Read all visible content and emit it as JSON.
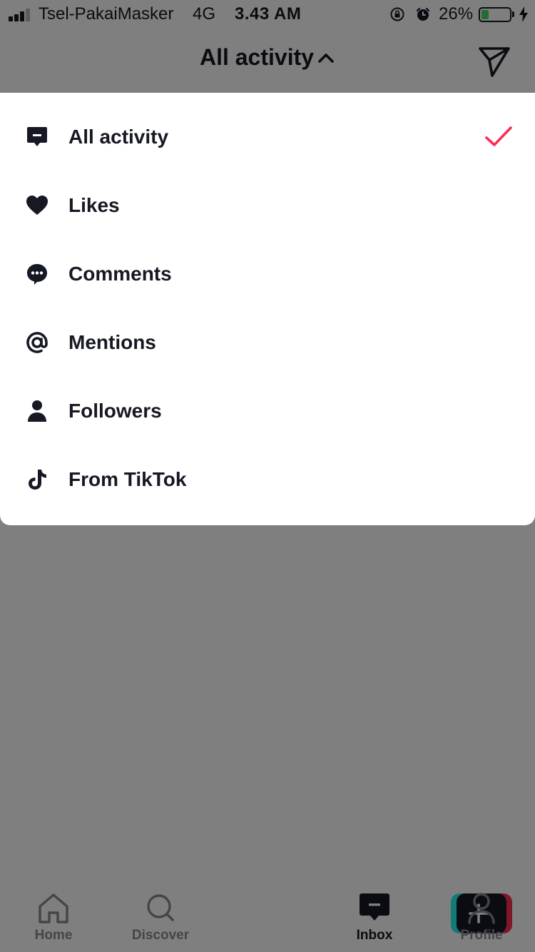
{
  "status_bar": {
    "carrier": "Tsel-PakaiMasker",
    "network": "4G",
    "time": "3.43 AM",
    "battery_percent": "26%",
    "battery_level": 0.26,
    "battery_color": "#4cd964"
  },
  "header": {
    "title": "All activity",
    "title_icon": "chevron-up-icon",
    "action_icon": "send-icon"
  },
  "menu": {
    "selected_index": 0,
    "check_color": "#fe2c55",
    "items": [
      {
        "label": "All activity",
        "icon": "inbox-message-icon"
      },
      {
        "label": "Likes",
        "icon": "heart-icon"
      },
      {
        "label": "Comments",
        "icon": "comment-icon"
      },
      {
        "label": "Mentions",
        "icon": "at-icon"
      },
      {
        "label": "Followers",
        "icon": "person-icon"
      },
      {
        "label": "From TikTok",
        "icon": "tiktok-icon"
      }
    ]
  },
  "bottom_nav": {
    "items": [
      {
        "label": "Home",
        "icon": "home-icon"
      },
      {
        "label": "Discover",
        "icon": "search-icon"
      },
      {
        "label": "",
        "icon": "create-plus-icon"
      },
      {
        "label": "Inbox",
        "icon": "inbox-icon",
        "active": true
      },
      {
        "label": "Profile",
        "icon": "profile-icon"
      }
    ]
  }
}
